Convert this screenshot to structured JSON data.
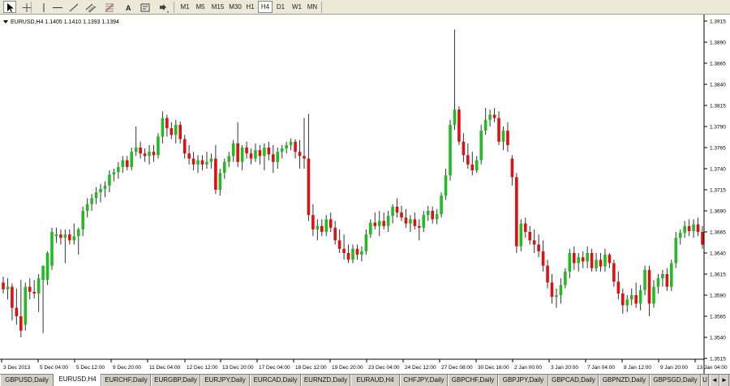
{
  "toolbar": {
    "tools": [
      {
        "name": "cursor-icon",
        "icon": "cursor"
      },
      {
        "name": "crosshair-icon",
        "icon": "crosshair"
      },
      {
        "name": "vertical-line-icon",
        "icon": "vertical-line"
      },
      {
        "name": "horizontal-line-icon",
        "icon": "horizontal-line"
      },
      {
        "name": "trendline-icon",
        "icon": "trendline"
      },
      {
        "name": "channel-icon",
        "icon": "channel"
      },
      {
        "name": "fibonacci-icon",
        "icon": "fibonacci"
      },
      {
        "name": "text-tool-icon",
        "icon": "text"
      },
      {
        "name": "label-tool-icon",
        "icon": "label"
      },
      {
        "name": "arrow-shapes-icon",
        "icon": "arrows"
      }
    ],
    "timeframes": [
      "M1",
      "M5",
      "M15",
      "M30",
      "H1",
      "H4",
      "D1",
      "W1",
      "MN"
    ],
    "active_timeframe": "H4"
  },
  "chart_title": "EURUSD,H4  1.1405 1.1410 1.1393 1.1394",
  "colors": {
    "bull": "#22bb22",
    "bear": "#dd1111",
    "wick": "#333333",
    "background": "#ffffff",
    "axis": "#000000"
  },
  "chart_data": {
    "type": "candlestick",
    "symbol": "EURUSD",
    "timeframe": "H4",
    "ylim": [
      1.353,
      1.392
    ],
    "y_ticks": [
      "1.3915",
      "1.3890",
      "1.3865",
      "1.3840",
      "1.3815",
      "1.3790",
      "1.3765",
      "1.3740",
      "1.3715",
      "1.3690",
      "1.3665",
      "1.3640",
      "1.3615",
      "1.3590",
      "1.3565",
      "1.3540",
      "1.3515"
    ],
    "x_tick_labels": [
      "3 Dec 2013",
      "5 Dec 04:00",
      "5 Dec 12:00",
      "9 Dec 20:00",
      "11 Dec 04:00",
      "12 Dec 12:00",
      "13 Dec 20:00",
      "17 Dec 04:00",
      "18 Dec 12:00",
      "19 Dec 20:00",
      "23 Dec 04:00",
      "24 Dec 12:00",
      "27 Dec 08:00",
      "30 Dec 16:00",
      "2 Jan 00:00",
      "3 Jan 20:00",
      "7 Jan 04:00",
      "8 Jan 12:00",
      "9 Jan 20:00",
      "13 Jan 04:00"
    ],
    "candles": [
      {
        "o": 1.3605,
        "h": 1.3612,
        "l": 1.3592,
        "c": 1.3597
      },
      {
        "o": 1.3597,
        "h": 1.361,
        "l": 1.3585,
        "c": 1.36
      },
      {
        "o": 1.36,
        "h": 1.3604,
        "l": 1.356,
        "c": 1.3575
      },
      {
        "o": 1.3575,
        "h": 1.3598,
        "l": 1.3555,
        "c": 1.3565
      },
      {
        "o": 1.3565,
        "h": 1.3608,
        "l": 1.354,
        "c": 1.3548
      },
      {
        "o": 1.3555,
        "h": 1.3605,
        "l": 1.3548,
        "c": 1.36
      },
      {
        "o": 1.36,
        "h": 1.361,
        "l": 1.3585,
        "c": 1.3594
      },
      {
        "o": 1.3594,
        "h": 1.3608,
        "l": 1.3586,
        "c": 1.3592
      },
      {
        "o": 1.3592,
        "h": 1.3615,
        "l": 1.357,
        "c": 1.361
      },
      {
        "o": 1.3608,
        "h": 1.3625,
        "l": 1.3545,
        "c": 1.3625
      },
      {
        "o": 1.3608,
        "h": 1.3642,
        "l": 1.3602,
        "c": 1.364
      },
      {
        "o": 1.3625,
        "h": 1.367,
        "l": 1.362,
        "c": 1.3665
      },
      {
        "o": 1.366,
        "h": 1.367,
        "l": 1.3652,
        "c": 1.3662
      },
      {
        "o": 1.3662,
        "h": 1.3668,
        "l": 1.365,
        "c": 1.3658
      },
      {
        "o": 1.3658,
        "h": 1.3668,
        "l": 1.3628,
        "c": 1.3662
      },
      {
        "o": 1.3662,
        "h": 1.3668,
        "l": 1.365,
        "c": 1.3655
      },
      {
        "o": 1.3655,
        "h": 1.3675,
        "l": 1.365,
        "c": 1.366
      },
      {
        "o": 1.366,
        "h": 1.367,
        "l": 1.3638,
        "c": 1.3668
      },
      {
        "o": 1.3668,
        "h": 1.3695,
        "l": 1.366,
        "c": 1.369
      },
      {
        "o": 1.369,
        "h": 1.3705,
        "l": 1.3682,
        "c": 1.3698
      },
      {
        "o": 1.3698,
        "h": 1.371,
        "l": 1.369,
        "c": 1.3705
      },
      {
        "o": 1.3705,
        "h": 1.3718,
        "l": 1.3698,
        "c": 1.3712
      },
      {
        "o": 1.3712,
        "h": 1.3722,
        "l": 1.37,
        "c": 1.3716
      },
      {
        "o": 1.3716,
        "h": 1.3725,
        "l": 1.3706,
        "c": 1.372
      },
      {
        "o": 1.372,
        "h": 1.3738,
        "l": 1.3712,
        "c": 1.3733
      },
      {
        "o": 1.3733,
        "h": 1.374,
        "l": 1.3725,
        "c": 1.3736
      },
      {
        "o": 1.3736,
        "h": 1.3748,
        "l": 1.3728,
        "c": 1.3742
      },
      {
        "o": 1.3742,
        "h": 1.3755,
        "l": 1.3735,
        "c": 1.375
      },
      {
        "o": 1.375,
        "h": 1.3755,
        "l": 1.3738,
        "c": 1.3742
      },
      {
        "o": 1.3742,
        "h": 1.3765,
        "l": 1.3738,
        "c": 1.376
      },
      {
        "o": 1.376,
        "h": 1.379,
        "l": 1.3755,
        "c": 1.3765
      },
      {
        "o": 1.3765,
        "h": 1.3772,
        "l": 1.3752,
        "c": 1.3758
      },
      {
        "o": 1.3758,
        "h": 1.3764,
        "l": 1.3748,
        "c": 1.3755
      },
      {
        "o": 1.3755,
        "h": 1.3768,
        "l": 1.3745,
        "c": 1.376
      },
      {
        "o": 1.376,
        "h": 1.3768,
        "l": 1.3748,
        "c": 1.3756
      },
      {
        "o": 1.3756,
        "h": 1.3782,
        "l": 1.3752,
        "c": 1.3778
      },
      {
        "o": 1.3778,
        "h": 1.3808,
        "l": 1.377,
        "c": 1.38
      },
      {
        "o": 1.38,
        "h": 1.3804,
        "l": 1.3778,
        "c": 1.3788
      },
      {
        "o": 1.3788,
        "h": 1.3795,
        "l": 1.3775,
        "c": 1.378
      },
      {
        "o": 1.378,
        "h": 1.3798,
        "l": 1.377,
        "c": 1.3792
      },
      {
        "o": 1.3792,
        "h": 1.3796,
        "l": 1.377,
        "c": 1.3775
      },
      {
        "o": 1.3775,
        "h": 1.378,
        "l": 1.3752,
        "c": 1.3758
      },
      {
        "o": 1.3758,
        "h": 1.3768,
        "l": 1.3745,
        "c": 1.3752
      },
      {
        "o": 1.3752,
        "h": 1.376,
        "l": 1.3738,
        "c": 1.3745
      },
      {
        "o": 1.3745,
        "h": 1.3756,
        "l": 1.3735,
        "c": 1.375
      },
      {
        "o": 1.375,
        "h": 1.3756,
        "l": 1.3738,
        "c": 1.3745
      },
      {
        "o": 1.3745,
        "h": 1.376,
        "l": 1.374,
        "c": 1.3748
      },
      {
        "o": 1.3748,
        "h": 1.3758,
        "l": 1.374,
        "c": 1.3752
      },
      {
        "o": 1.3752,
        "h": 1.3768,
        "l": 1.371,
        "c": 1.3715
      },
      {
        "o": 1.3715,
        "h": 1.374,
        "l": 1.3708,
        "c": 1.3735
      },
      {
        "o": 1.3735,
        "h": 1.3752,
        "l": 1.3728,
        "c": 1.3748
      },
      {
        "o": 1.3748,
        "h": 1.376,
        "l": 1.3742,
        "c": 1.3755
      },
      {
        "o": 1.3755,
        "h": 1.3774,
        "l": 1.3748,
        "c": 1.377
      },
      {
        "o": 1.377,
        "h": 1.3795,
        "l": 1.3742,
        "c": 1.3748
      },
      {
        "o": 1.3748,
        "h": 1.3768,
        "l": 1.3738,
        "c": 1.3765
      },
      {
        "o": 1.3765,
        "h": 1.3772,
        "l": 1.3752,
        "c": 1.3758
      },
      {
        "o": 1.3758,
        "h": 1.3764,
        "l": 1.3745,
        "c": 1.3752
      },
      {
        "o": 1.3752,
        "h": 1.377,
        "l": 1.3748,
        "c": 1.3762
      },
      {
        "o": 1.3762,
        "h": 1.3768,
        "l": 1.3745,
        "c": 1.3755
      },
      {
        "o": 1.3755,
        "h": 1.377,
        "l": 1.3738,
        "c": 1.3765
      },
      {
        "o": 1.3765,
        "h": 1.3772,
        "l": 1.375,
        "c": 1.3757
      },
      {
        "o": 1.3757,
        "h": 1.3768,
        "l": 1.3735,
        "c": 1.3748
      },
      {
        "o": 1.3748,
        "h": 1.3765,
        "l": 1.374,
        "c": 1.376
      },
      {
        "o": 1.376,
        "h": 1.3768,
        "l": 1.3752,
        "c": 1.3764
      },
      {
        "o": 1.3764,
        "h": 1.3772,
        "l": 1.3758,
        "c": 1.3768
      },
      {
        "o": 1.3768,
        "h": 1.3776,
        "l": 1.3762,
        "c": 1.3772
      },
      {
        "o": 1.3772,
        "h": 1.3775,
        "l": 1.3752,
        "c": 1.376
      },
      {
        "o": 1.376,
        "h": 1.3774,
        "l": 1.374,
        "c": 1.3755
      },
      {
        "o": 1.3755,
        "h": 1.38,
        "l": 1.374,
        "c": 1.3752
      },
      {
        "o": 1.3752,
        "h": 1.3805,
        "l": 1.3678,
        "c": 1.3685
      },
      {
        "o": 1.3685,
        "h": 1.3698,
        "l": 1.366,
        "c": 1.3668
      },
      {
        "o": 1.3668,
        "h": 1.368,
        "l": 1.3655,
        "c": 1.3672
      },
      {
        "o": 1.3672,
        "h": 1.368,
        "l": 1.366,
        "c": 1.3665
      },
      {
        "o": 1.3665,
        "h": 1.3685,
        "l": 1.366,
        "c": 1.368
      },
      {
        "o": 1.368,
        "h": 1.3688,
        "l": 1.3665,
        "c": 1.367
      },
      {
        "o": 1.367,
        "h": 1.3678,
        "l": 1.365,
        "c": 1.3655
      },
      {
        "o": 1.3655,
        "h": 1.3668,
        "l": 1.364,
        "c": 1.3645
      },
      {
        "o": 1.3645,
        "h": 1.3662,
        "l": 1.3632,
        "c": 1.364
      },
      {
        "o": 1.364,
        "h": 1.365,
        "l": 1.3628,
        "c": 1.3632
      },
      {
        "o": 1.3632,
        "h": 1.365,
        "l": 1.3628,
        "c": 1.3645
      },
      {
        "o": 1.3645,
        "h": 1.365,
        "l": 1.3632,
        "c": 1.3638
      },
      {
        "o": 1.3638,
        "h": 1.3648,
        "l": 1.363,
        "c": 1.3642
      },
      {
        "o": 1.3642,
        "h": 1.3668,
        "l": 1.3638,
        "c": 1.3662
      },
      {
        "o": 1.3662,
        "h": 1.368,
        "l": 1.3658,
        "c": 1.3676
      },
      {
        "o": 1.3676,
        "h": 1.3688,
        "l": 1.3668,
        "c": 1.3672
      },
      {
        "o": 1.3672,
        "h": 1.369,
        "l": 1.366,
        "c": 1.3678
      },
      {
        "o": 1.3678,
        "h": 1.3688,
        "l": 1.3668,
        "c": 1.3672
      },
      {
        "o": 1.3672,
        "h": 1.369,
        "l": 1.3665,
        "c": 1.3684
      },
      {
        "o": 1.3684,
        "h": 1.3698,
        "l": 1.3675,
        "c": 1.3695
      },
      {
        "o": 1.3695,
        "h": 1.3705,
        "l": 1.3682,
        "c": 1.3688
      },
      {
        "o": 1.3688,
        "h": 1.3696,
        "l": 1.3678,
        "c": 1.3682
      },
      {
        "o": 1.3682,
        "h": 1.3692,
        "l": 1.367,
        "c": 1.3675
      },
      {
        "o": 1.3675,
        "h": 1.3685,
        "l": 1.3665,
        "c": 1.368
      },
      {
        "o": 1.368,
        "h": 1.3688,
        "l": 1.3668,
        "c": 1.3672
      },
      {
        "o": 1.3672,
        "h": 1.368,
        "l": 1.3655,
        "c": 1.367
      },
      {
        "o": 1.367,
        "h": 1.369,
        "l": 1.3665,
        "c": 1.3685
      },
      {
        "o": 1.3685,
        "h": 1.3696,
        "l": 1.3678,
        "c": 1.369
      },
      {
        "o": 1.369,
        "h": 1.3695,
        "l": 1.3675,
        "c": 1.368
      },
      {
        "o": 1.368,
        "h": 1.3692,
        "l": 1.3674,
        "c": 1.3686
      },
      {
        "o": 1.3686,
        "h": 1.3712,
        "l": 1.3682,
        "c": 1.3708
      },
      {
        "o": 1.3708,
        "h": 1.374,
        "l": 1.3703,
        "c": 1.3732
      },
      {
        "o": 1.3732,
        "h": 1.3798,
        "l": 1.3726,
        "c": 1.3792
      },
      {
        "o": 1.3792,
        "h": 1.3905,
        "l": 1.3786,
        "c": 1.381
      },
      {
        "o": 1.381,
        "h": 1.3814,
        "l": 1.3768,
        "c": 1.3772
      },
      {
        "o": 1.3772,
        "h": 1.3782,
        "l": 1.3748,
        "c": 1.3756
      },
      {
        "o": 1.3756,
        "h": 1.377,
        "l": 1.374,
        "c": 1.3745
      },
      {
        "o": 1.3745,
        "h": 1.376,
        "l": 1.3732,
        "c": 1.3738
      },
      {
        "o": 1.3738,
        "h": 1.3755,
        "l": 1.3735,
        "c": 1.375
      },
      {
        "o": 1.375,
        "h": 1.3792,
        "l": 1.3745,
        "c": 1.3785
      },
      {
        "o": 1.3785,
        "h": 1.3812,
        "l": 1.378,
        "c": 1.3798
      },
      {
        "o": 1.3798,
        "h": 1.381,
        "l": 1.379,
        "c": 1.3804
      },
      {
        "o": 1.3804,
        "h": 1.3812,
        "l": 1.3795,
        "c": 1.38
      },
      {
        "o": 1.38,
        "h": 1.3808,
        "l": 1.3768,
        "c": 1.3772
      },
      {
        "o": 1.3772,
        "h": 1.379,
        "l": 1.3762,
        "c": 1.3785
      },
      {
        "o": 1.3785,
        "h": 1.3795,
        "l": 1.376,
        "c": 1.3768
      },
      {
        "o": 1.3752,
        "h": 1.3756,
        "l": 1.372,
        "c": 1.373
      },
      {
        "o": 1.373,
        "h": 1.3735,
        "l": 1.364,
        "c": 1.3648
      },
      {
        "o": 1.3648,
        "h": 1.368,
        "l": 1.3642,
        "c": 1.3675
      },
      {
        "o": 1.3675,
        "h": 1.3682,
        "l": 1.3658,
        "c": 1.3665
      },
      {
        "o": 1.3665,
        "h": 1.3672,
        "l": 1.365,
        "c": 1.3655
      },
      {
        "o": 1.3655,
        "h": 1.3668,
        "l": 1.364,
        "c": 1.365
      },
      {
        "o": 1.365,
        "h": 1.3662,
        "l": 1.3635,
        "c": 1.3642
      },
      {
        "o": 1.3642,
        "h": 1.3655,
        "l": 1.3618,
        "c": 1.3625
      },
      {
        "o": 1.3625,
        "h": 1.3632,
        "l": 1.3598,
        "c": 1.3605
      },
      {
        "o": 1.3605,
        "h": 1.3615,
        "l": 1.358,
        "c": 1.3588
      },
      {
        "o": 1.3588,
        "h": 1.3598,
        "l": 1.3575,
        "c": 1.359
      },
      {
        "o": 1.359,
        "h": 1.361,
        "l": 1.358,
        "c": 1.3602
      },
      {
        "o": 1.3602,
        "h": 1.3622,
        "l": 1.3598,
        "c": 1.3618
      },
      {
        "o": 1.3618,
        "h": 1.3645,
        "l": 1.361,
        "c": 1.364
      },
      {
        "o": 1.364,
        "h": 1.3648,
        "l": 1.362,
        "c": 1.3628
      },
      {
        "o": 1.3628,
        "h": 1.364,
        "l": 1.3618,
        "c": 1.3635
      },
      {
        "o": 1.3635,
        "h": 1.3642,
        "l": 1.3622,
        "c": 1.363
      },
      {
        "o": 1.363,
        "h": 1.3648,
        "l": 1.3622,
        "c": 1.364
      },
      {
        "o": 1.364,
        "h": 1.3645,
        "l": 1.3618,
        "c": 1.3622
      },
      {
        "o": 1.3622,
        "h": 1.364,
        "l": 1.3618,
        "c": 1.3632
      },
      {
        "o": 1.3632,
        "h": 1.364,
        "l": 1.3618,
        "c": 1.3624
      },
      {
        "o": 1.3624,
        "h": 1.3645,
        "l": 1.3618,
        "c": 1.3638
      },
      {
        "o": 1.3638,
        "h": 1.364,
        "l": 1.3622,
        "c": 1.3628
      },
      {
        "o": 1.3628,
        "h": 1.3632,
        "l": 1.36,
        "c": 1.3606
      },
      {
        "o": 1.3606,
        "h": 1.3618,
        "l": 1.3585,
        "c": 1.3592
      },
      {
        "o": 1.3592,
        "h": 1.3598,
        "l": 1.3568,
        "c": 1.3578
      },
      {
        "o": 1.3578,
        "h": 1.359,
        "l": 1.357,
        "c": 1.3585
      },
      {
        "o": 1.3585,
        "h": 1.3598,
        "l": 1.3578,
        "c": 1.359
      },
      {
        "o": 1.359,
        "h": 1.3605,
        "l": 1.3575,
        "c": 1.358
      },
      {
        "o": 1.358,
        "h": 1.3602,
        "l": 1.3572,
        "c": 1.3596
      },
      {
        "o": 1.3596,
        "h": 1.3625,
        "l": 1.359,
        "c": 1.362
      },
      {
        "o": 1.362,
        "h": 1.3625,
        "l": 1.3565,
        "c": 1.358
      },
      {
        "o": 1.358,
        "h": 1.3608,
        "l": 1.3575,
        "c": 1.36
      },
      {
        "o": 1.36,
        "h": 1.3615,
        "l": 1.3592,
        "c": 1.361
      },
      {
        "o": 1.361,
        "h": 1.362,
        "l": 1.36,
        "c": 1.3615
      },
      {
        "o": 1.3615,
        "h": 1.3622,
        "l": 1.3595,
        "c": 1.36
      },
      {
        "o": 1.36,
        "h": 1.3632,
        "l": 1.3595,
        "c": 1.3628
      },
      {
        "o": 1.3628,
        "h": 1.3665,
        "l": 1.3622,
        "c": 1.3658
      },
      {
        "o": 1.3658,
        "h": 1.3668,
        "l": 1.365,
        "c": 1.3664
      },
      {
        "o": 1.3664,
        "h": 1.3678,
        "l": 1.3658,
        "c": 1.3672
      },
      {
        "o": 1.3672,
        "h": 1.368,
        "l": 1.366,
        "c": 1.3666
      },
      {
        "o": 1.3666,
        "h": 1.368,
        "l": 1.3658,
        "c": 1.3674
      },
      {
        "o": 1.3674,
        "h": 1.3682,
        "l": 1.366,
        "c": 1.3665
      },
      {
        "o": 1.3665,
        "h": 1.3672,
        "l": 1.3645,
        "c": 1.365
      }
    ]
  },
  "symbol_tabs": [
    {
      "label": "GBPUSD,Daily",
      "active": false
    },
    {
      "label": "EURUSD,H4",
      "active": true
    },
    {
      "label": "EURCHF,Daily",
      "active": false
    },
    {
      "label": "EURGBP,Daily",
      "active": false
    },
    {
      "label": "EURJPY,Daily",
      "active": false
    },
    {
      "label": "EURCAD,Daily",
      "active": false
    },
    {
      "label": "EURNZD,Daily",
      "active": false
    },
    {
      "label": "EURAUD,H4",
      "active": false
    },
    {
      "label": "CHFJPY,Daily",
      "active": false
    },
    {
      "label": "GBPCHF,Daily",
      "active": false
    },
    {
      "label": "GBPJPY,Daily",
      "active": false
    },
    {
      "label": "GBPCAD,Daily",
      "active": false
    },
    {
      "label": "GBPNZD,Daily",
      "active": false
    },
    {
      "label": "GBPSGD,Daily",
      "active": false
    },
    {
      "label": "U",
      "active": false
    }
  ],
  "tab_nav": {
    "left": "◄",
    "right": "►"
  }
}
